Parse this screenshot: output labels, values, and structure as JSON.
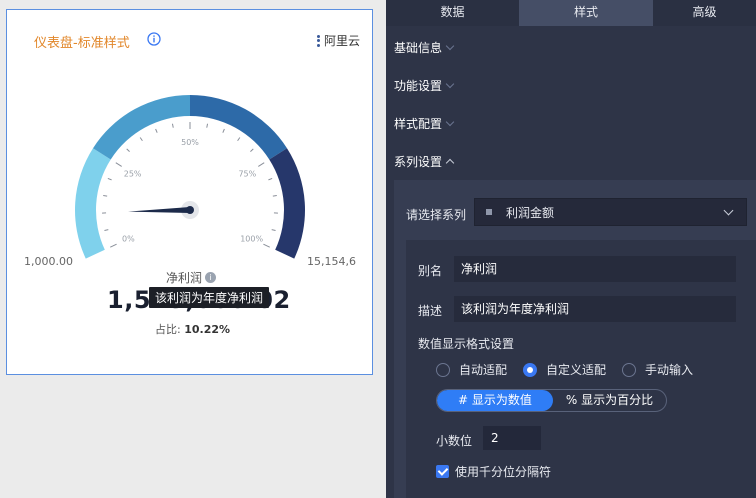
{
  "card": {
    "title": "仪表盘-标准样式",
    "brand": "阿里云",
    "gauge": {
      "min_label": "1,000.00",
      "max_label": "15,154,6",
      "ticks": [
        "0%",
        "25%",
        "50%",
        "75%",
        "100%"
      ],
      "pointer_fraction": 0.1022,
      "name": "净利润",
      "value": "1,54",
      "value_tail": "5,000.02",
      "tooltip": "该利润为年度净利润",
      "ratio_label": "占比:",
      "ratio_value": "10.22%",
      "colors": [
        "#7fd1ec",
        "#4a9dcc",
        "#2d6aa8",
        "#26376b"
      ]
    }
  },
  "panel": {
    "tabs": [
      "数据",
      "样式",
      "高级"
    ],
    "active_tab": "样式",
    "sections": [
      "基础信息",
      "功能设置",
      "样式配置",
      "系列设置"
    ],
    "series": {
      "select_label": "请选择系列",
      "selected": "利润金额",
      "alias_label": "别名",
      "alias_value": "净利润",
      "desc_label": "描述",
      "desc_value": "该利润为年度净利润",
      "format_title": "数值显示格式设置",
      "format_options": [
        "自动适配",
        "自定义适配",
        "手动输入"
      ],
      "format_selected": "自定义适配",
      "display_modes": [
        "# 显示为数值",
        "% 显示为百分比"
      ],
      "display_selected": "# 显示为数值",
      "decimals_label": "小数位",
      "decimals_value": "2",
      "thousands_label": "使用千分位分隔符",
      "thousands_checked": true
    }
  }
}
